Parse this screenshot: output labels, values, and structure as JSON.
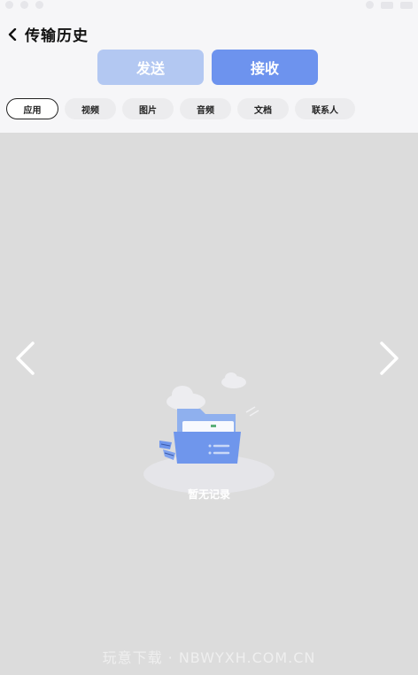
{
  "header": {
    "title": "传输历史",
    "back_icon": "chevron-left-icon"
  },
  "segments": {
    "send_label": "发送",
    "receive_label": "接收",
    "selected": "接收"
  },
  "tabs": [
    {
      "label": "应用",
      "active": true
    },
    {
      "label": "视频",
      "active": false
    },
    {
      "label": "图片",
      "active": false
    },
    {
      "label": "音频",
      "active": false
    },
    {
      "label": "文档",
      "active": false
    },
    {
      "label": "联系人",
      "active": false
    }
  ],
  "content": {
    "empty_text": "暂无记录",
    "left_arrow_icon": "chevron-left-icon",
    "right_arrow_icon": "chevron-right-icon",
    "illustration": "empty-folder-illustration"
  },
  "watermark": "玩意下载 · NBWYXH.COM.CN",
  "colors": {
    "send_button": "#b3c8f2",
    "receive_button": "#6d93ee",
    "content_bg": "#dcdcdc",
    "header_bg": "#f6f6f8"
  }
}
